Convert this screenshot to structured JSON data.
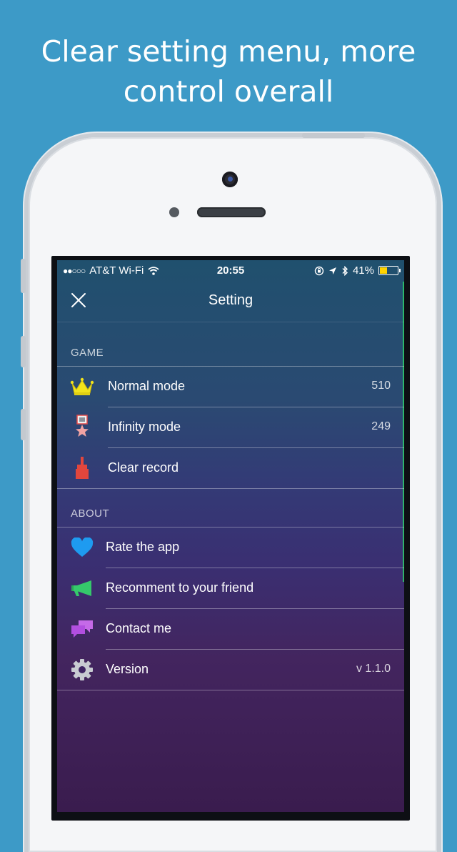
{
  "headline": "Clear setting menu, more control overall",
  "status_bar": {
    "carrier": "AT&T Wi-Fi",
    "signal_dots": "●●○○○",
    "time": "20:55",
    "battery": "41%",
    "battery_level_fraction": 0.41
  },
  "nav": {
    "title": "Setting"
  },
  "sections": {
    "game": {
      "header": "GAME",
      "items": [
        {
          "label": "Normal mode",
          "value": "510",
          "icon": "crown-icon"
        },
        {
          "label": "Infinity mode",
          "value": "249",
          "icon": "medal-icon"
        },
        {
          "label": "Clear record",
          "icon": "brush-icon"
        }
      ]
    },
    "about": {
      "header": "ABOUT",
      "items": [
        {
          "label": "Rate the app",
          "icon": "heart-icon"
        },
        {
          "label": "Recomment to your friend",
          "icon": "megaphone-icon"
        },
        {
          "label": "Contact me",
          "icon": "chat-bubbles-icon"
        },
        {
          "label": "Version",
          "value": "v 1.1.0",
          "icon": "gear-icon"
        }
      ]
    }
  },
  "colors": {
    "background": "#3d9ac7",
    "crown": "#f2e31b",
    "heart": "#1e9bf0",
    "megaphone": "#35c96b",
    "chat": "#b24fe0",
    "brush": "#e2463d",
    "gear": "#c8cbd2"
  }
}
